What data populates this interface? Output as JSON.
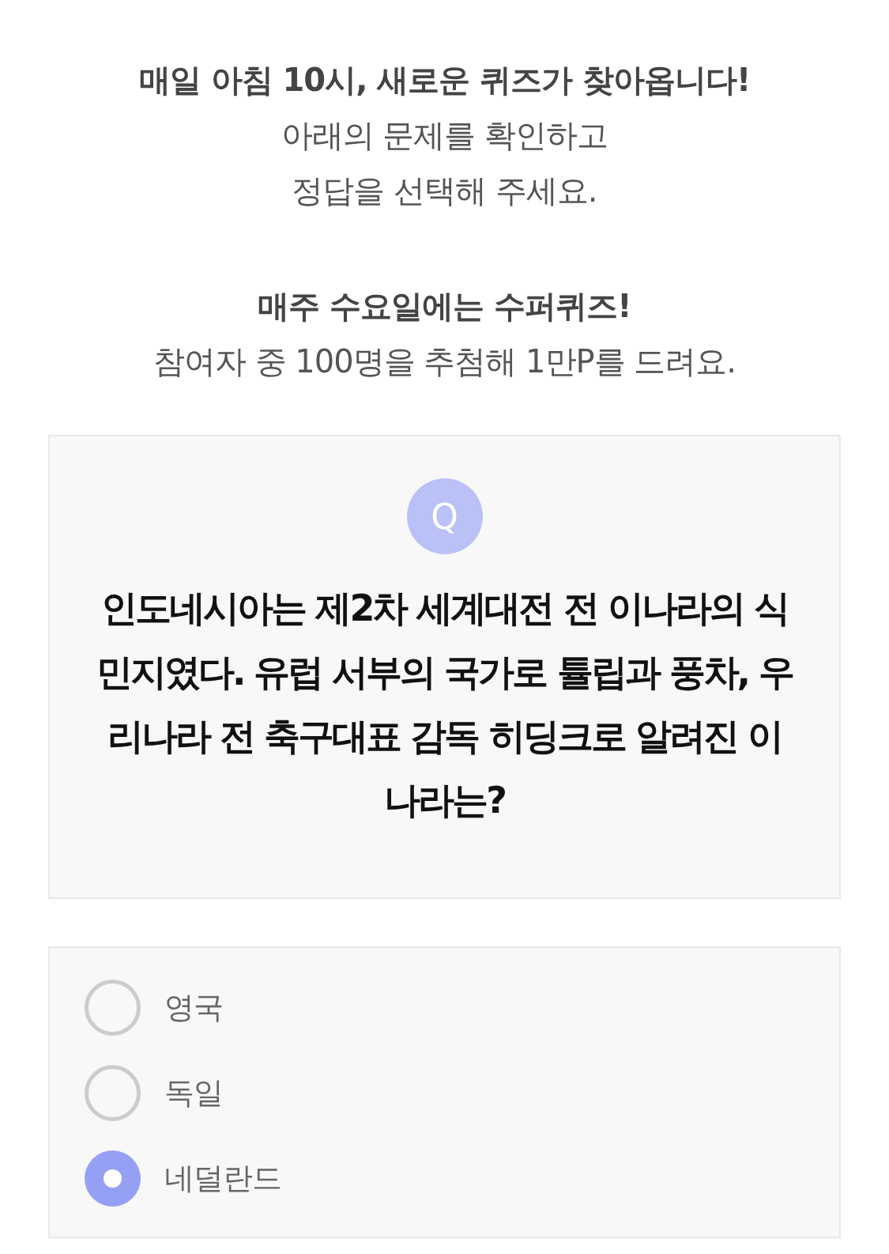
{
  "intro": [
    {
      "title": "매일 아침 10시, 새로운 퀴즈가 찾아옵니다!",
      "body": [
        "아래의 문제를 확인하고",
        "정답을 선택해 주세요."
      ]
    },
    {
      "title": "매주 수요일에는 수퍼퀴즈!",
      "body": [
        "참여자 중 100명을 추첨해 1만P를 드려요."
      ]
    }
  ],
  "question": {
    "badge": "Q",
    "text": "인도네시아는 제2차 세계대전 전 이나라의 식민지였다. 유럽 서부의 국가로 튤립과 풍차, 우리나라 전 축구대표 감독 히딩크로 알려진 이 나라는?"
  },
  "options": [
    {
      "label": "영국",
      "selected": false
    },
    {
      "label": "독일",
      "selected": false
    },
    {
      "label": "네덜란드",
      "selected": true
    }
  ]
}
